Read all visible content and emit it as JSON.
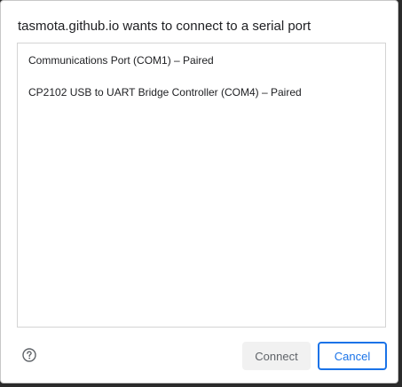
{
  "dialog": {
    "title": "tasmota.github.io wants to connect to a serial port",
    "ports": [
      {
        "label": "Communications Port (COM1) – Paired"
      },
      {
        "label": "CP2102 USB to UART Bridge Controller (COM4) – Paired"
      }
    ],
    "help_icon": "help-circle-icon",
    "buttons": {
      "connect_label": "Connect",
      "connect_enabled": false,
      "cancel_label": "Cancel"
    }
  },
  "colors": {
    "accent": "#1a73e8",
    "disabled_button_bg": "#f1f1f1",
    "disabled_button_text": "#5f6368",
    "text": "#202124"
  }
}
